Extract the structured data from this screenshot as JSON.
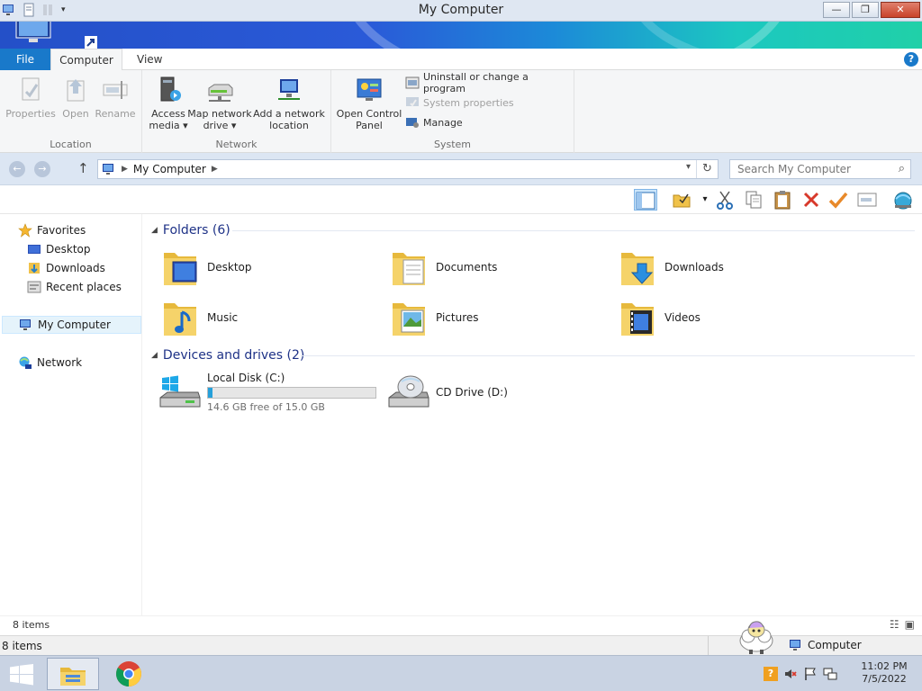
{
  "window": {
    "title": "My Computer",
    "controls": {
      "minimize": "—",
      "maximize": "❐",
      "close": "✕"
    }
  },
  "ribbon_tabs": {
    "file": "File",
    "computer": "Computer",
    "view": "View",
    "help": "?"
  },
  "ribbon": {
    "location": {
      "label": "Location",
      "properties": "Properties",
      "open": "Open",
      "rename": "Rename"
    },
    "network": {
      "label": "Network",
      "access_media_1": "Access",
      "access_media_2": "media ▾",
      "map_drive_1": "Map network",
      "map_drive_2": "drive ▾",
      "add_location_1": "Add a network",
      "add_location_2": "location"
    },
    "system": {
      "label": "System",
      "control_panel_1": "Open Control",
      "control_panel_2": "Panel",
      "uninstall": "Uninstall or change a program",
      "system_properties": "System properties",
      "manage": "Manage"
    }
  },
  "address": {
    "back": "←",
    "forward": "→",
    "up": "↑",
    "path": "My Computer",
    "separator": "▶",
    "dropdown": "▾",
    "refresh": "↻",
    "search_placeholder": "Search My Computer",
    "search_icon": "⌕"
  },
  "toolbar_icons": [
    "layout-icon",
    "folder-options-icon",
    "cut-icon",
    "copy-icon",
    "paste-icon",
    "delete-icon",
    "checkmark-icon",
    "rename-icon",
    "globe-icon"
  ],
  "nav": {
    "favorites": "Favorites",
    "desktop": "Desktop",
    "downloads": "Downloads",
    "recent": "Recent places",
    "computer": "My Computer",
    "network": "Network"
  },
  "folders": {
    "heading": "Folders (6)",
    "items": [
      "Desktop",
      "Documents",
      "Downloads",
      "Music",
      "Pictures",
      "Videos"
    ]
  },
  "devices": {
    "heading": "Devices and drives (2)",
    "local_disk": {
      "name": "Local Disk (C:)",
      "free_text": "14.6 GB free of 15.0 GB",
      "used_fraction": 0.027
    },
    "cd_drive": {
      "name": "CD Drive (D:)"
    }
  },
  "status": {
    "count": "8 items"
  },
  "infobar": {
    "count": "8 items",
    "location": "Computer"
  },
  "clock": {
    "time": "11:02 PM",
    "date": "7/5/2022"
  },
  "colors": {
    "accent": "#1979ca",
    "usage_fill": "#26a0da",
    "heading": "#1e3287"
  }
}
